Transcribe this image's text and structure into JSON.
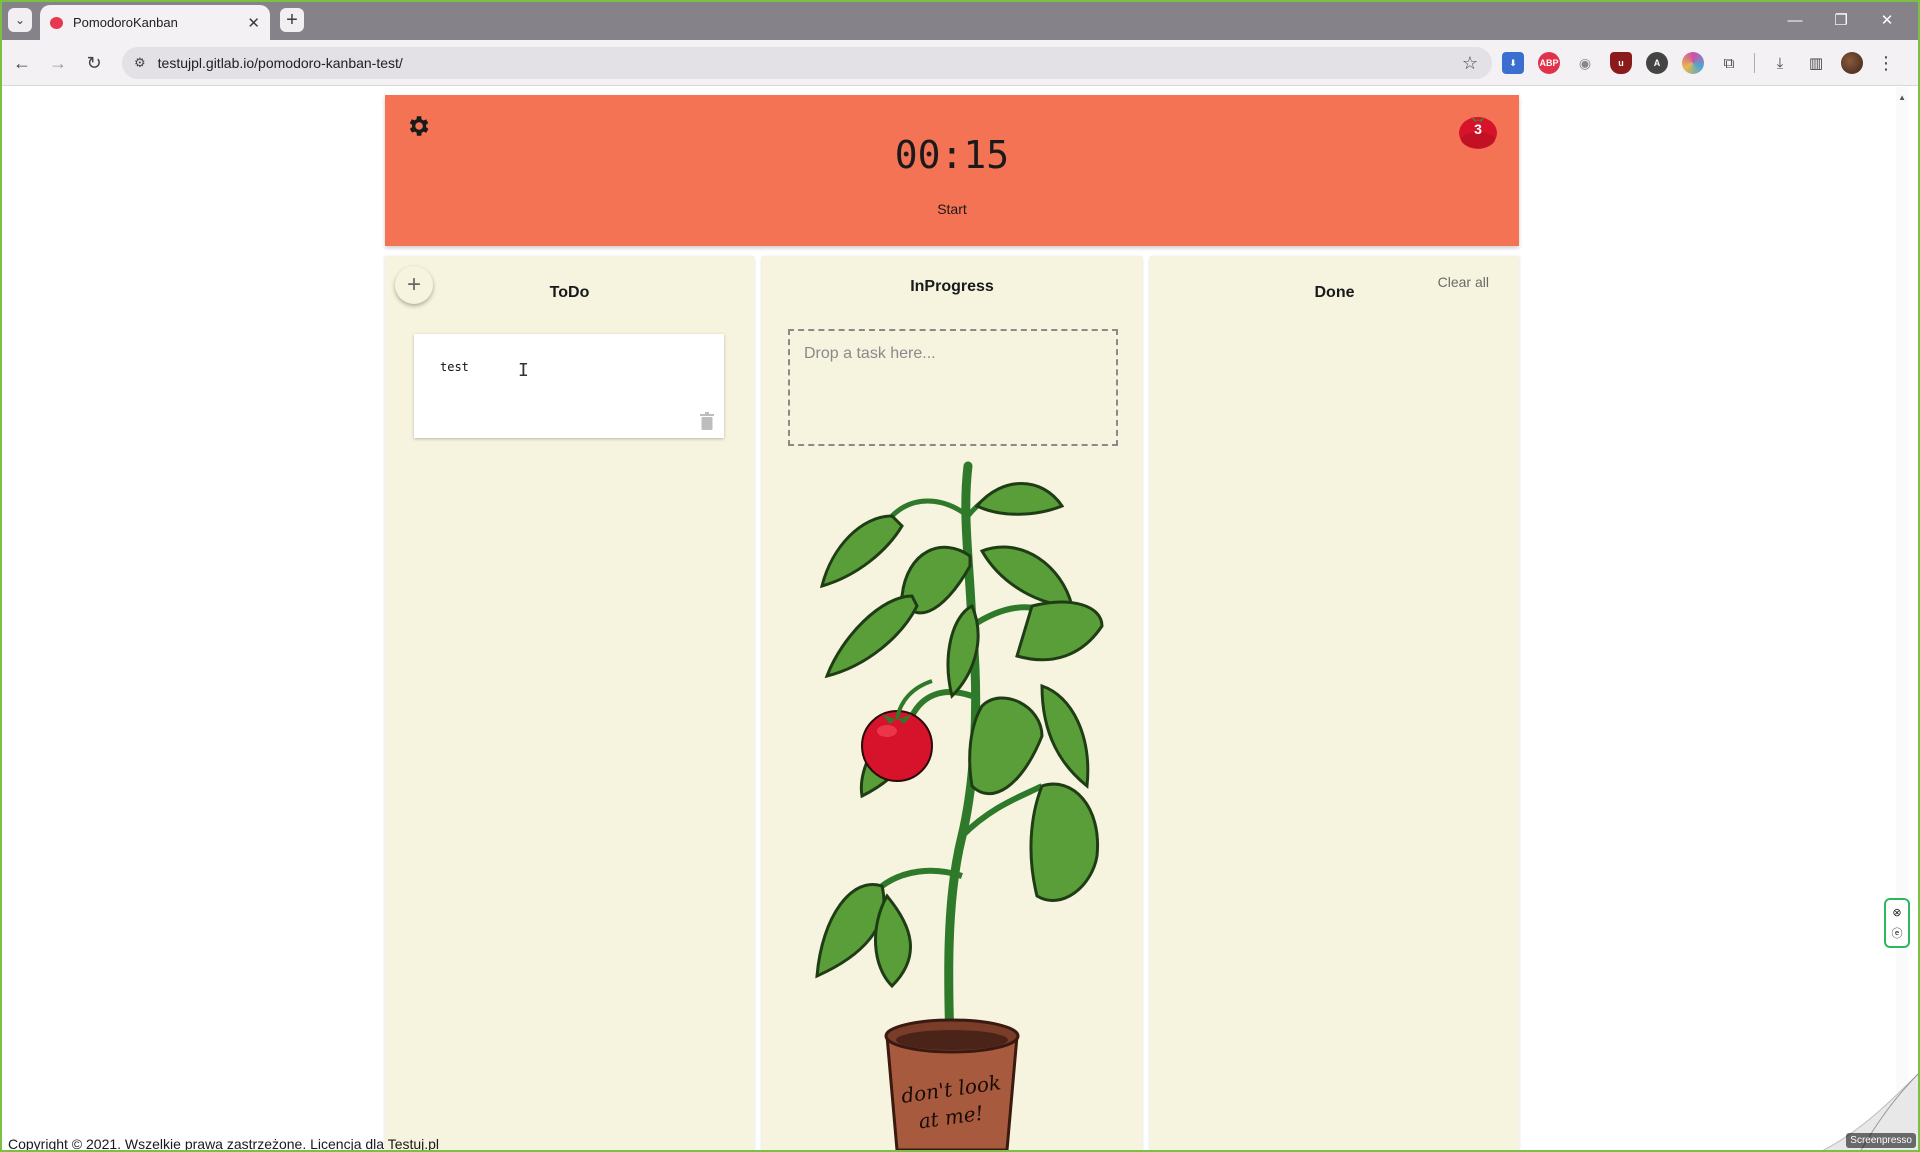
{
  "browser": {
    "tab_title": "PomodoroKanban",
    "url": "testujpl.gitlab.io/pomodoro-kanban-test/",
    "window_controls": [
      "minimize",
      "maximize",
      "close"
    ],
    "extensions": [
      {
        "name": "save-extension-icon",
        "color": "#3a6fd1"
      },
      {
        "name": "adblock-icon",
        "label": "ABP",
        "color": "#e0324a"
      },
      {
        "name": "camera-extension-icon",
        "color": "#888888"
      },
      {
        "name": "ublock-icon",
        "color": "#8b1a1a"
      },
      {
        "name": "extension-a-icon",
        "color": "#444444"
      },
      {
        "name": "extension-color-icon",
        "color": "#d14ea8"
      },
      {
        "name": "puzzle-icon",
        "color": "#555555"
      }
    ]
  },
  "timer": {
    "display": "00:15",
    "start_label": "Start",
    "pomodoro_count": "3",
    "bar_color": "#f47355"
  },
  "board": {
    "columns": [
      {
        "title": "ToDo"
      },
      {
        "title": "InProgress"
      },
      {
        "title": "Done"
      }
    ],
    "todo_tasks": [
      {
        "text": "test"
      }
    ],
    "drop_zone_placeholder": "Drop a task here...",
    "clear_all_label": "Clear all",
    "add_symbol": "+",
    "plant_text_line1": "don't look",
    "plant_text_line2": "at me!",
    "column_color": "#f6f3df"
  },
  "footer": {
    "text": "Copyright © 2021. Wszelkie prawa zastrzeżone. Licencja dla Testuj.pl"
  },
  "watermark": {
    "text": "Screenpresso"
  }
}
